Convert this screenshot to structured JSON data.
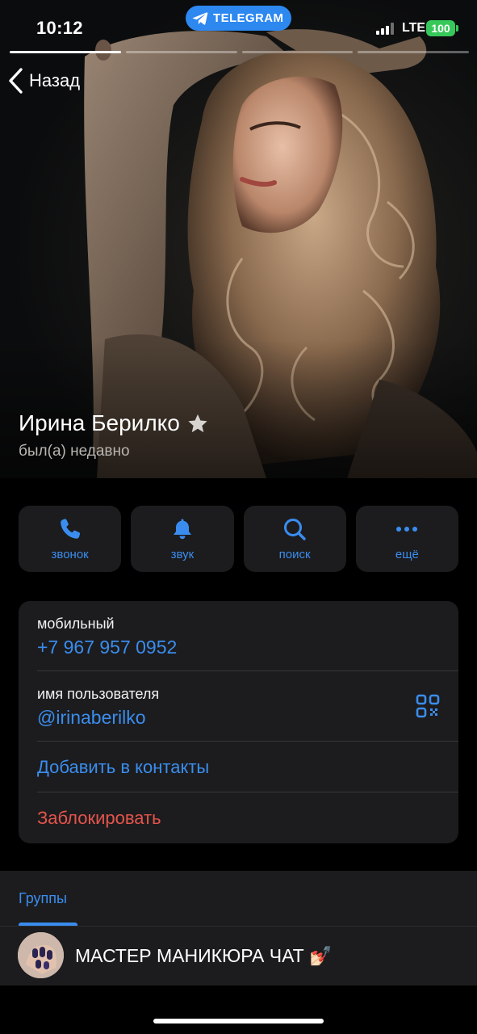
{
  "status_bar": {
    "time": "10:12",
    "app_pill": "TELEGRAM",
    "network": "LTE",
    "battery": "100"
  },
  "nav": {
    "back_label": "Назад"
  },
  "profile": {
    "name": "Ирина Берилко",
    "status": "был(а) недавно"
  },
  "actions": [
    {
      "label": "звонок",
      "icon": "phone-icon"
    },
    {
      "label": "звук",
      "icon": "bell-icon"
    },
    {
      "label": "поиск",
      "icon": "search-icon"
    },
    {
      "label": "ещё",
      "icon": "more-icon"
    }
  ],
  "info": {
    "mobile_caption": "мобильный",
    "mobile_value": "+7 967 957 0952",
    "username_caption": "имя пользователя",
    "username_value": "@irinaberilko",
    "add_contact": "Добавить в контакты",
    "block": "Заблокировать"
  },
  "groups": {
    "tab_label": "Группы",
    "items": [
      {
        "title": "МАСТЕР МАНИКЮРА ЧАТ 💅🏻"
      }
    ]
  },
  "colors": {
    "accent": "#3a8dee",
    "danger": "#e5544b",
    "card_bg": "#1c1c1e",
    "telegram_pill": "#2d88f0",
    "battery": "#37c85a"
  }
}
